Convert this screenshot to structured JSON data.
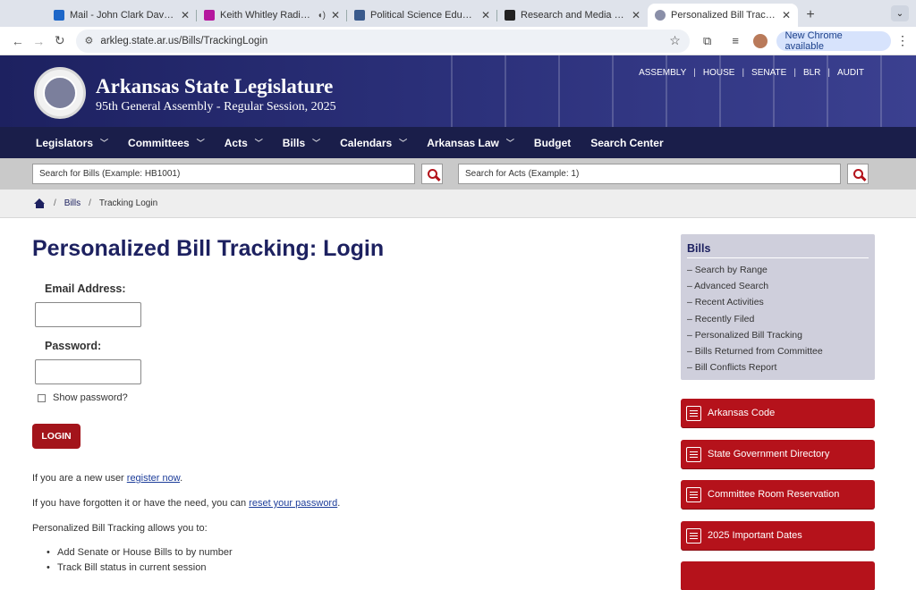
{
  "browser": {
    "tabs": [
      {
        "title": "Mail - John Clark Davis - Outl",
        "favicon_color": "#1e67c8",
        "active": false
      },
      {
        "title": "Keith Whitley Radio - Now",
        "favicon_color": "#b5179e",
        "active": false
      },
      {
        "title": "Political Science Educator: Vo",
        "favicon_color": "#3a5a8c",
        "active": false
      },
      {
        "title": "Research and Media Sources",
        "favicon_color": "#222222",
        "active": false
      },
      {
        "title": "Personalized Bill Tracking: Lo",
        "favicon_color": "#8a8fa8",
        "active": true
      }
    ],
    "url": "arkleg.state.ar.us/Bills/TrackingLogin",
    "update_label": "New Chrome available"
  },
  "header": {
    "title": "Arkansas State Legislature",
    "subtitle": "95th General Assembly - Regular Session, 2025",
    "top_links": [
      "ASSEMBLY",
      "HOUSE",
      "SENATE",
      "BLR",
      "AUDIT"
    ]
  },
  "nav": {
    "items": [
      {
        "label": "Legislators",
        "dropdown": true
      },
      {
        "label": "Committees",
        "dropdown": true
      },
      {
        "label": "Acts",
        "dropdown": true
      },
      {
        "label": "Bills",
        "dropdown": true
      },
      {
        "label": "Calendars",
        "dropdown": true
      },
      {
        "label": "Arkansas Law",
        "dropdown": true
      },
      {
        "label": "Budget",
        "dropdown": false
      },
      {
        "label": "Search Center",
        "dropdown": false
      }
    ]
  },
  "search": {
    "bills_placeholder": "Search for Bills (Example: HB1001)",
    "acts_placeholder": "Search for Acts (Example: 1)"
  },
  "breadcrumb": {
    "bills": "Bills",
    "current": "Tracking Login"
  },
  "main": {
    "title": "Personalized Bill Tracking: Login",
    "email_label": "Email Address:",
    "password_label": "Password:",
    "show_password": "Show password?",
    "login_button": "LOGIN",
    "new_user_text": "If you are a new user ",
    "register_link": "register now",
    "forgot_text": "If you have forgotten it or have the need, you can ",
    "reset_link": "reset your password",
    "allows_text": "Personalized Bill Tracking allows you to:",
    "bullets": [
      "Add Senate or House Bills to by number",
      "Track Bill status in current session"
    ]
  },
  "sidebar": {
    "heading": "Bills",
    "links": [
      "– Search by Range",
      "– Advanced Search",
      "– Recent Activities",
      "– Recently Filed",
      "– Personalized Bill Tracking",
      "– Bills Returned from Committee",
      "– Bill Conflicts Report"
    ],
    "buttons": [
      "Arkansas Code",
      "State Government Directory",
      "Committee Room Reservation",
      "2025 Important Dates"
    ]
  },
  "colors": {
    "brand_navy": "#1d2160",
    "accent_red": "#b5121b"
  }
}
